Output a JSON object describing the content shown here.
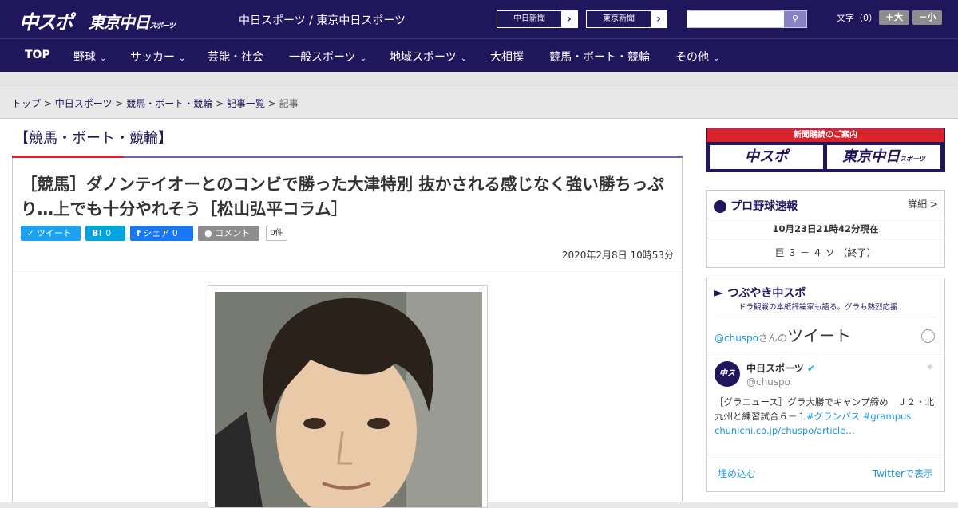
{
  "header": {
    "logo_main": "中スポ",
    "logo_tokyo": "東京中日",
    "logo_tokyo_small": "スポーツ",
    "site_name": "中日スポーツ / 東京中日スポーツ",
    "paper_links": [
      {
        "label": "中日新聞"
      },
      {
        "label": "東京新聞"
      }
    ],
    "search_placeholder": "",
    "font_size_label": "文字（0）",
    "font_up": "＋大",
    "font_down": "－小"
  },
  "nav": [
    {
      "label": "TOP"
    },
    {
      "label": "野球"
    },
    {
      "label": "サッカー"
    },
    {
      "label": "芸能・社会"
    },
    {
      "label": "一般スポーツ"
    },
    {
      "label": "地域スポーツ"
    },
    {
      "label": "大相撲"
    },
    {
      "label": "競馬・ボート・競輪"
    },
    {
      "label": "その他"
    }
  ],
  "breadcrumb": {
    "items": [
      "トップ",
      "中日スポーツ",
      "競馬・ボート・競輪",
      "記事一覧"
    ],
    "current": "記事",
    "separator": ">"
  },
  "category": "【競馬・ボート・競輪】",
  "article": {
    "title": "［競馬］ダノンテイオーとのコンビで勝った大津特別 抜かされる感じなく強い勝ちっぷり…上でも十分やれそう［松山弘平コラム］",
    "share": {
      "tweet": "ツイート",
      "hatena": "B!",
      "hatena_count": "0",
      "facebook": "シェア",
      "facebook_count": "0",
      "comment": "コメント",
      "comment_count": "0件"
    },
    "date": "2020年2月8日 10時53分"
  },
  "sidebar": {
    "ad": {
      "header": "新聞購読のご案内",
      "left": "中スポ",
      "right": "東京中日",
      "right_small": "スポーツ"
    },
    "baseball": {
      "title": "プロ野球速報",
      "more": "詳細 >",
      "time": "10月23日21時42分現在",
      "score": "巨 ３ － ４ ソ （終了）"
    },
    "tweets": {
      "title": "つぶやき中スポ",
      "subtitle": "ドラ観戦の本紙評論家も語る。グラも熱烈応援",
      "account": "@chuspo",
      "account_suffix": "さんの",
      "heading": "ツイート",
      "name": "中日スポーツ",
      "handle": "@chuspo",
      "text": "［グラニュース］グラ大勝でキャンプ締め　Ｊ２・北九州と練習試合６－１",
      "hashtags": "#グランパス #grampus",
      "link": "chunichi.co.jp/chuspo/article…",
      "embed": "埋め込む",
      "view": "Twitterで表示"
    }
  },
  "colors": {
    "brand": "#20165b",
    "accent": "#d8232a",
    "twitter": "#1da1f2",
    "facebook": "#1877f2",
    "hatena": "#00a4de"
  }
}
